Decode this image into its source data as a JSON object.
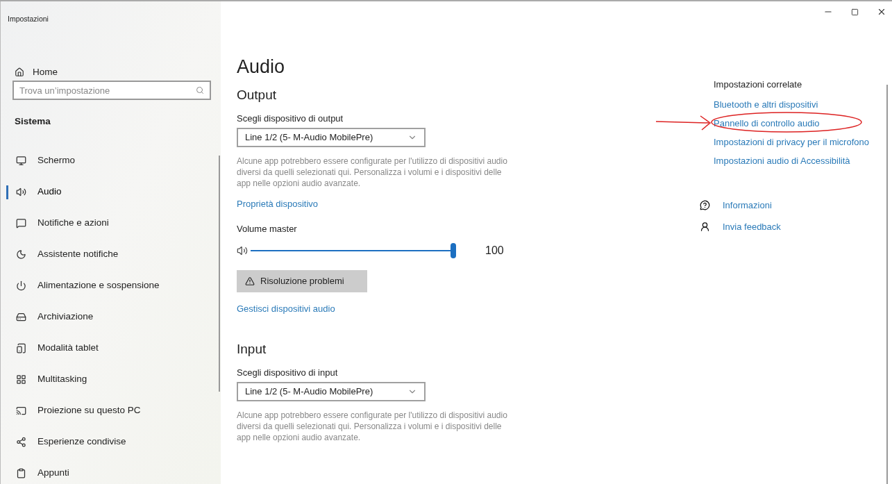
{
  "window": {
    "title": "Impostazioni"
  },
  "sidebar": {
    "home": "Home",
    "search": {
      "placeholder": "Trova un’impostazione"
    },
    "section": "Sistema",
    "items": [
      {
        "label": "Schermo",
        "selected": false
      },
      {
        "label": "Audio",
        "selected": true
      },
      {
        "label": "Notifiche e azioni",
        "selected": false
      },
      {
        "label": "Assistente notifiche",
        "selected": false
      },
      {
        "label": "Alimentazione e sospensione",
        "selected": false
      },
      {
        "label": "Archiviazione",
        "selected": false
      },
      {
        "label": "Modalità tablet",
        "selected": false
      },
      {
        "label": "Multitasking",
        "selected": false
      },
      {
        "label": "Proiezione su questo PC",
        "selected": false
      },
      {
        "label": "Esperienze condivise",
        "selected": false
      },
      {
        "label": "Appunti",
        "selected": false
      }
    ]
  },
  "page": {
    "title": "Audio",
    "sections": [
      {
        "heading": "Output",
        "device_label": "Scegli dispositivo di output",
        "device": "Line 1/2 (5- M-Audio MobilePre)",
        "description": "Alcune app potrebbero essere configurate per l'utilizzo di dispositivi audio diversi da quelli selezionati qui. Personalizza i volumi e i dispositivi delle app nelle opzioni audio avanzate.",
        "link": "Proprietà dispositivo",
        "volume": {
          "label": "Volume master",
          "level": 1.0,
          "reading": "100"
        },
        "troubleshoot": "Risoluzione problemi",
        "manage_link": "Gestisci dispositivi audio"
      },
      {
        "heading": "Input",
        "device_label": "Scegli dispositivo di input",
        "device": "Line 1/2 (5- M-Audio MobilePre)",
        "description": "Alcune app potrebbero essere configurate per l'utilizzo di dispositivi audio diversi da quelli selezionati qui. Personalizza i volumi e i dispositivi delle app nelle opzioni audio avanzate."
      }
    ]
  },
  "related": {
    "title": "Impostazioni correlate",
    "links": [
      {
        "label": "Bluetooth e altri dispositivi",
        "circled": false
      },
      {
        "label": "Pannello di controllo audio",
        "circled": true
      },
      {
        "label": "Impostazioni di privacy per il microfono",
        "circled": false
      },
      {
        "label": "Impostazioni audio di Accessibilità",
        "circled": false
      }
    ]
  },
  "help": [
    {
      "kind": "info",
      "label": "Informazioni"
    },
    {
      "kind": "feedback",
      "label": "Invia feedback"
    }
  ]
}
